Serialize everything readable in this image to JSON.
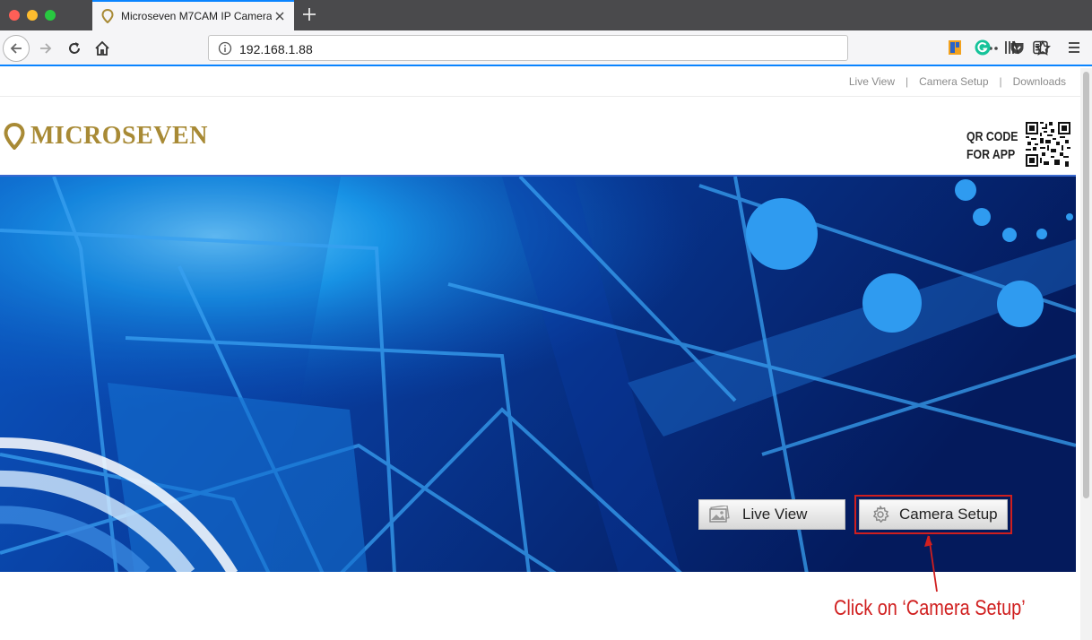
{
  "browser": {
    "tab_title": "Microseven M7CAM IP Camera",
    "url": "192.168.1.88",
    "colors": {
      "titlebar": "#4a4a4c",
      "accent": "#0a84ff"
    }
  },
  "topnav": {
    "items": [
      "Live View",
      "Camera Setup",
      "Downloads"
    ],
    "separator": "|"
  },
  "header": {
    "logo_text": "MICROSEVEN",
    "logo_color": "#a88a35",
    "qr_label_line1": "QR CODE",
    "qr_label_line2": "FOR APP"
  },
  "hero": {
    "live_view_label": "Live View",
    "camera_setup_label": "Camera Setup"
  },
  "annotation": {
    "callout_text": "Click on ‘Camera Setup’",
    "color": "#d01f1f"
  },
  "icons": [
    "back-icon",
    "forward-icon",
    "reload-icon",
    "home-icon",
    "info-icon",
    "more-icon",
    "pocket-icon",
    "star-icon",
    "extension-icon",
    "grammarly-icon",
    "library-icon",
    "sidebar-icon",
    "menu-icon",
    "image-icon",
    "gear-icon"
  ]
}
